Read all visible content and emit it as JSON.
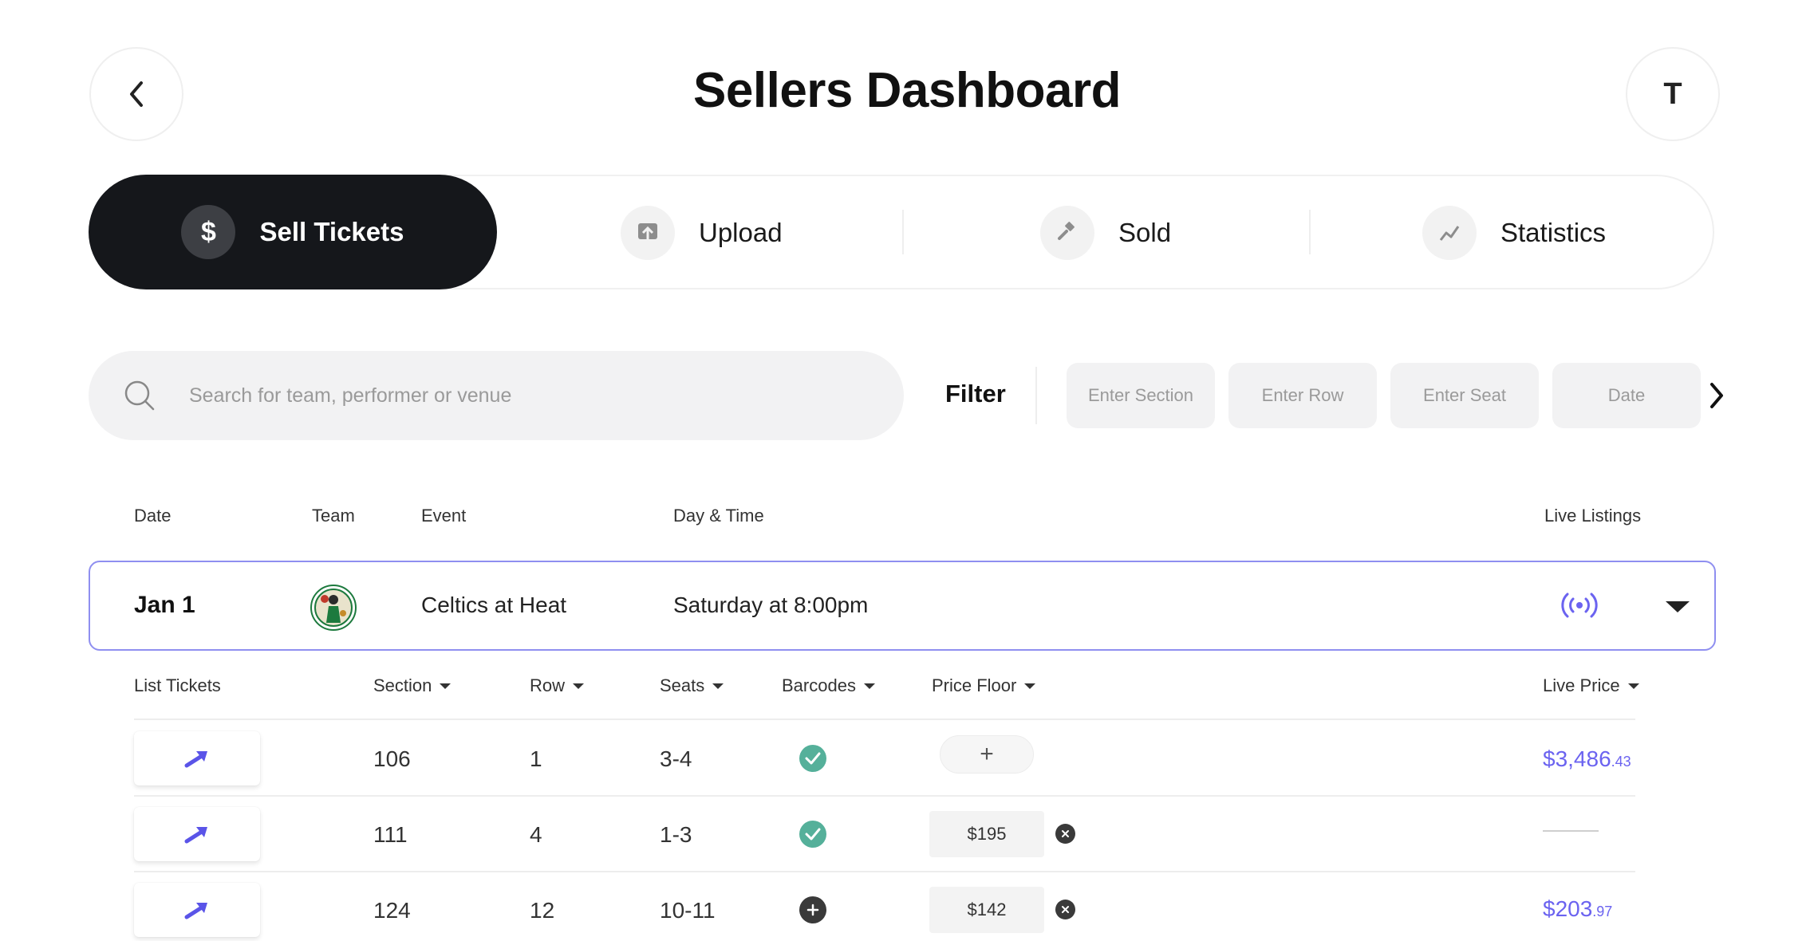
{
  "header": {
    "title": "Sellers Dashboard",
    "avatar_letter": "T"
  },
  "tabs": [
    {
      "label": "Sell Tickets",
      "icon": "dollar-icon",
      "active": true
    },
    {
      "label": "Upload",
      "icon": "upload-icon",
      "active": false
    },
    {
      "label": "Sold",
      "icon": "gavel-icon",
      "active": false
    },
    {
      "label": "Statistics",
      "icon": "chart-line-icon",
      "active": false
    }
  ],
  "search": {
    "placeholder": "Search for team, performer or venue",
    "filter_label": "Filter",
    "chips": [
      {
        "placeholder": "Enter Section"
      },
      {
        "placeholder": "Enter Row"
      },
      {
        "placeholder": "Enter Seat"
      },
      {
        "placeholder": "Date"
      }
    ]
  },
  "events_table": {
    "headers": {
      "date": "Date",
      "team": "Team",
      "event": "Event",
      "day_time": "Day & Time",
      "live_listings": "Live Listings"
    },
    "event": {
      "date": "Jan 1",
      "team_logo": "celtics-logo-icon",
      "name": "Celtics at Heat",
      "day_time": "Saturday at 8:00pm",
      "live_icon": "broadcast-icon"
    }
  },
  "tickets_table": {
    "headers": {
      "list": "List Tickets",
      "section": "Section",
      "row": "Row",
      "seats": "Seats",
      "barcodes": "Barcodes",
      "price_floor": "Price Floor",
      "live_price": "Live Price"
    },
    "rows": [
      {
        "section": "106",
        "row": "1",
        "seats": "3-4",
        "barcode": "uploaded",
        "price_floor": "+",
        "live_price_main": "$3,486",
        "live_price_cents": ".43"
      },
      {
        "section": "111",
        "row": "4",
        "seats": "1-3",
        "barcode": "uploaded",
        "price_floor": "$195",
        "live_price_main": "",
        "live_price_cents": ""
      },
      {
        "section": "124",
        "row": "12",
        "seats": "10-11",
        "barcode": "missing",
        "price_floor": "$142",
        "live_price_main": "$203",
        "live_price_cents": ".97"
      }
    ]
  },
  "colors": {
    "dark": "#15171b",
    "accent": "#6b63f0",
    "success": "#55b09a",
    "row_border": "#8f8ff0"
  }
}
